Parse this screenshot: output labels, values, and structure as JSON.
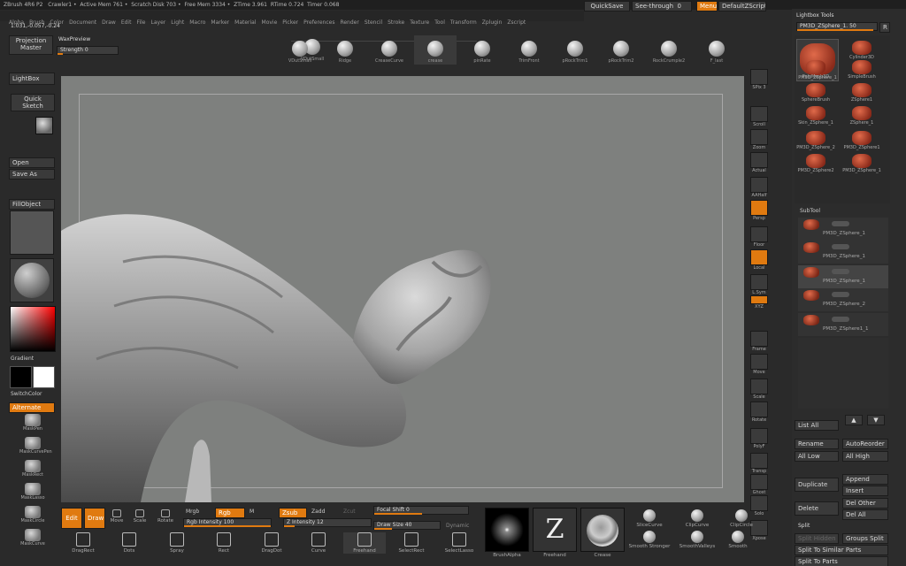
{
  "title": {
    "app": "ZBrush 4R6 P2",
    "doc": "Crawler1",
    "active_mem": "Active Mem 761",
    "scratch": "Scratch Disk 703",
    "free_mem": "Free Mem 3334",
    "ztime": "ZTime 3.961",
    "rtime": "RTime 0.724",
    "timer": "Timer 0.068"
  },
  "topright": {
    "quicksave": "QuickSave",
    "seethrough": "See-through",
    "seethrough_val": "0",
    "menus": "Menus",
    "script": "DefaultZScript"
  },
  "menus": [
    "Alpha",
    "Brush",
    "Color",
    "Document",
    "Draw",
    "Edit",
    "File",
    "Layer",
    "Light",
    "Macro",
    "Marker",
    "Material",
    "Movie",
    "Picker",
    "Preferences",
    "Render",
    "Stencil",
    "Stroke",
    "Texture",
    "Tool",
    "Transform",
    "Zplugin",
    "Zscript"
  ],
  "coords": "1.031,-0.057,-0.24",
  "left": {
    "projection_master": "Projection Master",
    "waxpreview": "WaxPreview",
    "strength": "Strength 0",
    "lightbox": "LightBox",
    "quick_sketch": "Quick Sketch",
    "open": "Open",
    "save_as": "Save As",
    "fillobject": "FillObject",
    "gradient": "Gradient",
    "switchcolor": "SwitchColor",
    "alternate": "Alternate"
  },
  "alphas": [
    "MaskPen",
    "MaskCurvePen",
    "MaskRect",
    "MaskLasso",
    "MaskCircle",
    "MaskCurve"
  ],
  "brushes": [
    "VDutSmall",
    "Ridge",
    "CreaseCurve",
    "crease",
    "pinRate",
    "TrimFront",
    "pRockTrim1",
    "pRockTrim2",
    "RockCrumple2",
    "F_last"
  ],
  "right_strip": [
    "SPix 3",
    "Scroll",
    "Zoom",
    "Actual",
    "AAHalf",
    "Persp",
    "Floor",
    "Local",
    "L.Sym",
    "XYZ",
    "Frame",
    "Move",
    "Scale",
    "Rotate",
    "PolyF",
    "Transp",
    "Ghost",
    "Solo",
    "Xpose"
  ],
  "lightbox_tools": {
    "title": "Lightbox Tools",
    "current": "PM3D_ZSphere_1. 50",
    "r": "R"
  },
  "tools": [
    {
      "name": "PM3D_ZSphere_1"
    },
    {
      "name": "Cylinder3D"
    },
    {
      "name": "PolyMesh3D"
    },
    {
      "name": "SimpleBrush"
    },
    {
      "name": "SphereBrush"
    },
    {
      "name": "ZSphere1"
    },
    {
      "name": "Skin_ZSphere_1"
    },
    {
      "name": "ZSphere_1"
    },
    {
      "name": "PM3D_ZSphere_2"
    },
    {
      "name": "PM3D_ZSphere1"
    },
    {
      "name": "PM3D_ZSphere2"
    },
    {
      "name": "PM3D_ZSphere_1"
    }
  ],
  "subtool": {
    "title": "SubTool",
    "items": [
      "PM3D_ZSphere_1",
      "PM3D_ZSphere_1",
      "PM3D_ZSphere_1",
      "PM3D_ZSphere_2",
      "PM3D_ZSphere1_1"
    ]
  },
  "subtool_buttons": {
    "list_all": "List All",
    "rename": "Rename",
    "autoreorder": "AutoReorder",
    "all_low": "All Low",
    "all_high": "All High",
    "duplicate": "Duplicate",
    "append": "Append",
    "insert": "Insert",
    "delete": "Delete",
    "del_other": "Del Other",
    "del_all": "Del All",
    "split": "Split",
    "split_hidden": "Split Hidden",
    "groups_split": "Groups Split",
    "split_similar": "Split To Similar Parts",
    "split_parts": "Split To Parts"
  },
  "bottom": {
    "edit": "Edit",
    "draw": "Draw",
    "move": "Move",
    "scale": "Scale",
    "rotate": "Rotate",
    "mrgb": "Mrgb",
    "rgb": "Rgb",
    "m": "M",
    "zsub": "Zsub",
    "zadd": "Zadd",
    "zcut": "Zcut",
    "rgb_intensity": "Rgb Intensity 100",
    "z_intensity": "Z Intensity 12",
    "focal_shift": "Focal Shift 0",
    "draw_size": "Draw Size 40",
    "dynamic": "Dynamic",
    "dragrect": "DragRect",
    "dots": "Dots",
    "spray": "Spray",
    "rect": "Rect",
    "dragdot": "DragDot",
    "curve": "Curve",
    "freehand": "Freehand",
    "selectrect": "SelectRect",
    "selectlasso": "SelectLasso",
    "brushalpha": "BrushAlpha",
    "freehand2": "Freehand",
    "crease": "Crease",
    "slicecurve": "SliceCurve",
    "clipcurve": "ClipCurve",
    "clipcircle": "ClipCircle",
    "smooth_stronger": "Smooth Stronger",
    "smoothvalleys": "SmoothValleys",
    "smooth": "Smooth"
  }
}
